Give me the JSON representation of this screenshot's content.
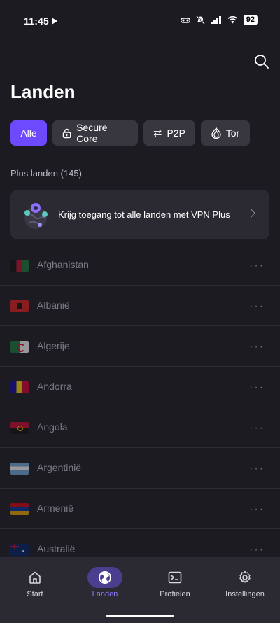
{
  "status": {
    "time": "11:45",
    "battery": "92"
  },
  "header": {
    "title": "Landen",
    "search_icon": "search-icon"
  },
  "filters": [
    {
      "label": "Alle",
      "icon": ""
    },
    {
      "label": "Secure Core",
      "icon": "lock-shield-icon"
    },
    {
      "label": "P2P",
      "icon": "arrows-swap-icon"
    },
    {
      "label": "Tor",
      "icon": "onion-icon"
    }
  ],
  "section": {
    "label": "Plus landen (145)"
  },
  "upsell": {
    "text": "Krijg toegang tot alle landen met VPN Plus"
  },
  "countries": [
    "Afghanistan",
    "Albanië",
    "Algerije",
    "Andorra",
    "Angola",
    "Argentinië",
    "Armenië",
    "Australië"
  ],
  "more_label": "···",
  "tabs": [
    {
      "label": "Start",
      "icon": "home-icon"
    },
    {
      "label": "Landen",
      "icon": "globe-icon"
    },
    {
      "label": "Profielen",
      "icon": "terminal-profile-icon"
    },
    {
      "label": "Instellingen",
      "icon": "gear-icon"
    }
  ],
  "colors": {
    "accent": "#6d4aff",
    "background": "#1c1b22",
    "surface": "#2b2a33"
  }
}
